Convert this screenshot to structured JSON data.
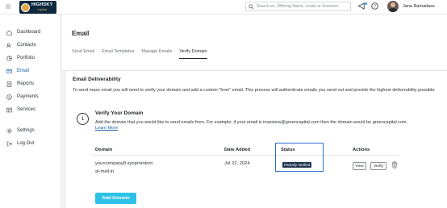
{
  "brand": {
    "name": "HIGHSKY",
    "tagline": "capital"
  },
  "search": {
    "placeholder": "Search ex. Offering Name, Leads or Investors"
  },
  "user": {
    "name": "Jana Ramadass"
  },
  "sidebar": {
    "items": [
      {
        "label": "Dashboard",
        "icon": "home-icon"
      },
      {
        "label": "Contacts",
        "icon": "contacts-icon"
      },
      {
        "label": "Portfolio",
        "icon": "portfolio-icon"
      },
      {
        "label": "Email",
        "icon": "email-icon",
        "active": true
      },
      {
        "label": "Reports",
        "icon": "reports-icon"
      },
      {
        "label": "Payments",
        "icon": "payments-icon"
      },
      {
        "label": "Services",
        "icon": "services-icon"
      },
      {
        "label": "Settings",
        "icon": "settings-icon"
      },
      {
        "label": "Log Out",
        "icon": "logout-icon"
      }
    ]
  },
  "header": {
    "title": "Email",
    "tabs": [
      "Send Email",
      "Email Templates",
      "Manage Emails",
      "Verify Domain"
    ],
    "active_tab": "Verify Domain"
  },
  "deliverability": {
    "title": "Email Deliverability",
    "description": "To send mass email you will need to verify your domain and add a custom \"from\" email. This process will authenticate emails you send out and provide the highest deliverability possible."
  },
  "step": {
    "number": "1",
    "title": "Verify Your Domain",
    "description": "Add the domain that you would like to send emails from. For example, if your email is investors@greencapital.com then the domain would be greencapital.com.",
    "link": "Learn More"
  },
  "table": {
    "headers": {
      "domain": "Domain",
      "date": "Date Added",
      "status": "Status",
      "actions": "Actions"
    },
    "rows": [
      {
        "domain_line1": "yourcompany8.synprointern",
        "domain_line2": "al-mail.in",
        "date": "Jul 22, 2024",
        "status": "Partially Verified",
        "view": "View",
        "verify": "Verify"
      }
    ]
  },
  "add_button": "Add Domain",
  "colors": {
    "accent": "#1a5fa8",
    "add_button": "#2dc1e6",
    "badge": "#1f3550",
    "highlight_border": "#2a6fd1"
  }
}
